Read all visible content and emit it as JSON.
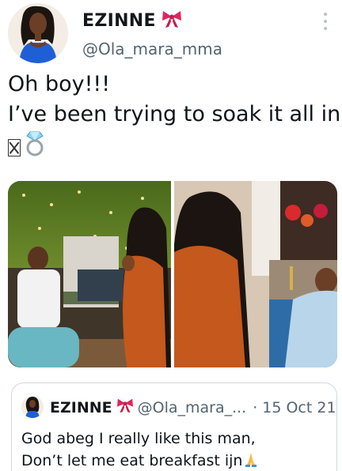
{
  "tweet": {
    "author": {
      "display_name": "EZINNE",
      "handle": "@Ola_mara_mma",
      "name_emoji": "ribbon-icon"
    },
    "text_lines": [
      "Oh boy!!!",
      "I’ve been trying to soak it all in"
    ],
    "trailing_emojis": [
      "missing-glyph-icon",
      "ring-icon"
    ],
    "media_count": 2
  },
  "quoted_tweet": {
    "display_name": "EZINNE",
    "name_emoji": "ribbon-icon",
    "handle": "@Ola_mara_...",
    "separator": "·",
    "date": "15 Oct 21",
    "text_lines": [
      "God abeg I really like this man,",
      "Don’t let me eat breakfast  ijn"
    ],
    "trailing_emoji": "folded-hands-icon"
  },
  "colors": {
    "text": "#0f1419",
    "secondary": "#536471",
    "border": "#cfd9de",
    "ribbon": "#e0245e"
  }
}
